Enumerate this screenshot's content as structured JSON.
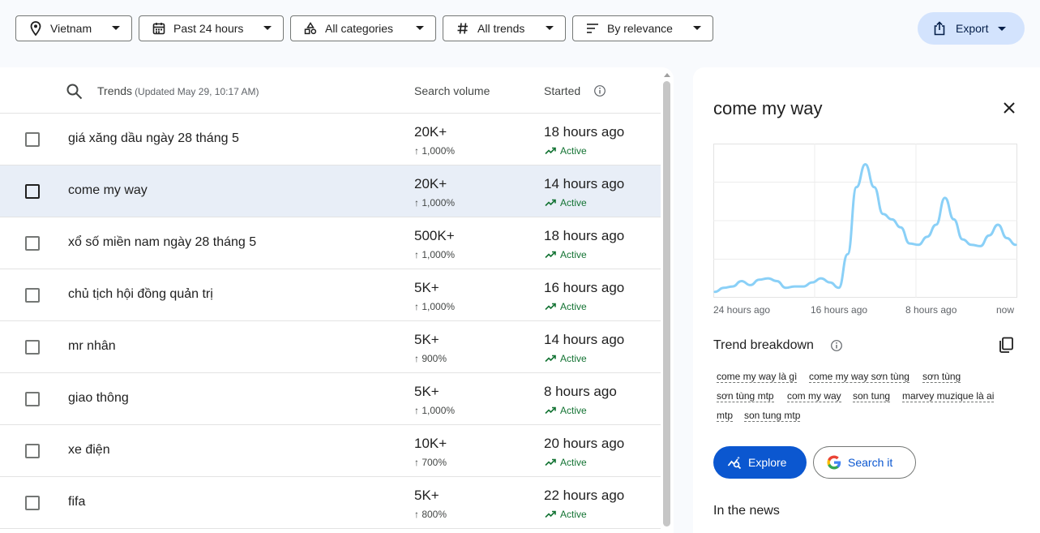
{
  "filters": {
    "location": "Vietnam",
    "time": "Past 24 hours",
    "category": "All categories",
    "trend_type": "All trends",
    "sort": "By relevance",
    "export": "Export"
  },
  "table": {
    "trends_header": "Trends",
    "updated": "(Updated May 29, 10:17 AM)",
    "volume_header": "Search volume",
    "started_header": "Started",
    "rows": [
      {
        "title": "giá xăng dầu ngày 28 tháng 5",
        "volume": "20K+",
        "change": "↑ 1,000%",
        "started": "18 hours ago",
        "status": "Active"
      },
      {
        "title": "come my way",
        "volume": "20K+",
        "change": "↑ 1,000%",
        "started": "14 hours ago",
        "status": "Active"
      },
      {
        "title": "xổ số miền nam ngày 28 tháng 5",
        "volume": "500K+",
        "change": "↑ 1,000%",
        "started": "18 hours ago",
        "status": "Active"
      },
      {
        "title": "chủ tịch hội đồng quản trị",
        "volume": "5K+",
        "change": "↑ 1,000%",
        "started": "16 hours ago",
        "status": "Active"
      },
      {
        "title": "mr nhân",
        "volume": "5K+",
        "change": "↑ 900%",
        "started": "14 hours ago",
        "status": "Active"
      },
      {
        "title": "giao thông",
        "volume": "5K+",
        "change": "↑ 1,000%",
        "started": "8 hours ago",
        "status": "Active"
      },
      {
        "title": "xe điện",
        "volume": "10K+",
        "change": "↑ 700%",
        "started": "20 hours ago",
        "status": "Active"
      },
      {
        "title": "fifa",
        "volume": "5K+",
        "change": "↑ 800%",
        "started": "22 hours ago",
        "status": "Active"
      }
    ]
  },
  "panel": {
    "title": "come my way",
    "chart_x_labels": [
      "24 hours ago",
      "16 hours ago",
      "8 hours ago",
      "now"
    ],
    "breakdown_title": "Trend breakdown",
    "chips": [
      "come my way là gì",
      "come my way sơn tùng",
      "sơn tùng",
      "sơn tùng mtp",
      "com my way",
      "son tung",
      "marvey muzique là ai",
      "mtp",
      "son tung mtp"
    ],
    "explore_label": "Explore",
    "search_label": "Search it",
    "news_title": "In the news"
  },
  "chart_data": {
    "type": "line",
    "x_labels": [
      "24 hours ago",
      "16 hours ago",
      "8 hours ago",
      "now"
    ],
    "series": [
      {
        "values": [
          2,
          5,
          6,
          10,
          7,
          11,
          12,
          10,
          5,
          6,
          6,
          9,
          12,
          9,
          5,
          30,
          80,
          97,
          80,
          60,
          56,
          50,
          38,
          37,
          43,
          52,
          72,
          56,
          41,
          37,
          36,
          44,
          52,
          42,
          37
        ]
      }
    ],
    "ylim": [
      0,
      110
    ],
    "grid": true,
    "line_color": "#8ad0f7"
  }
}
